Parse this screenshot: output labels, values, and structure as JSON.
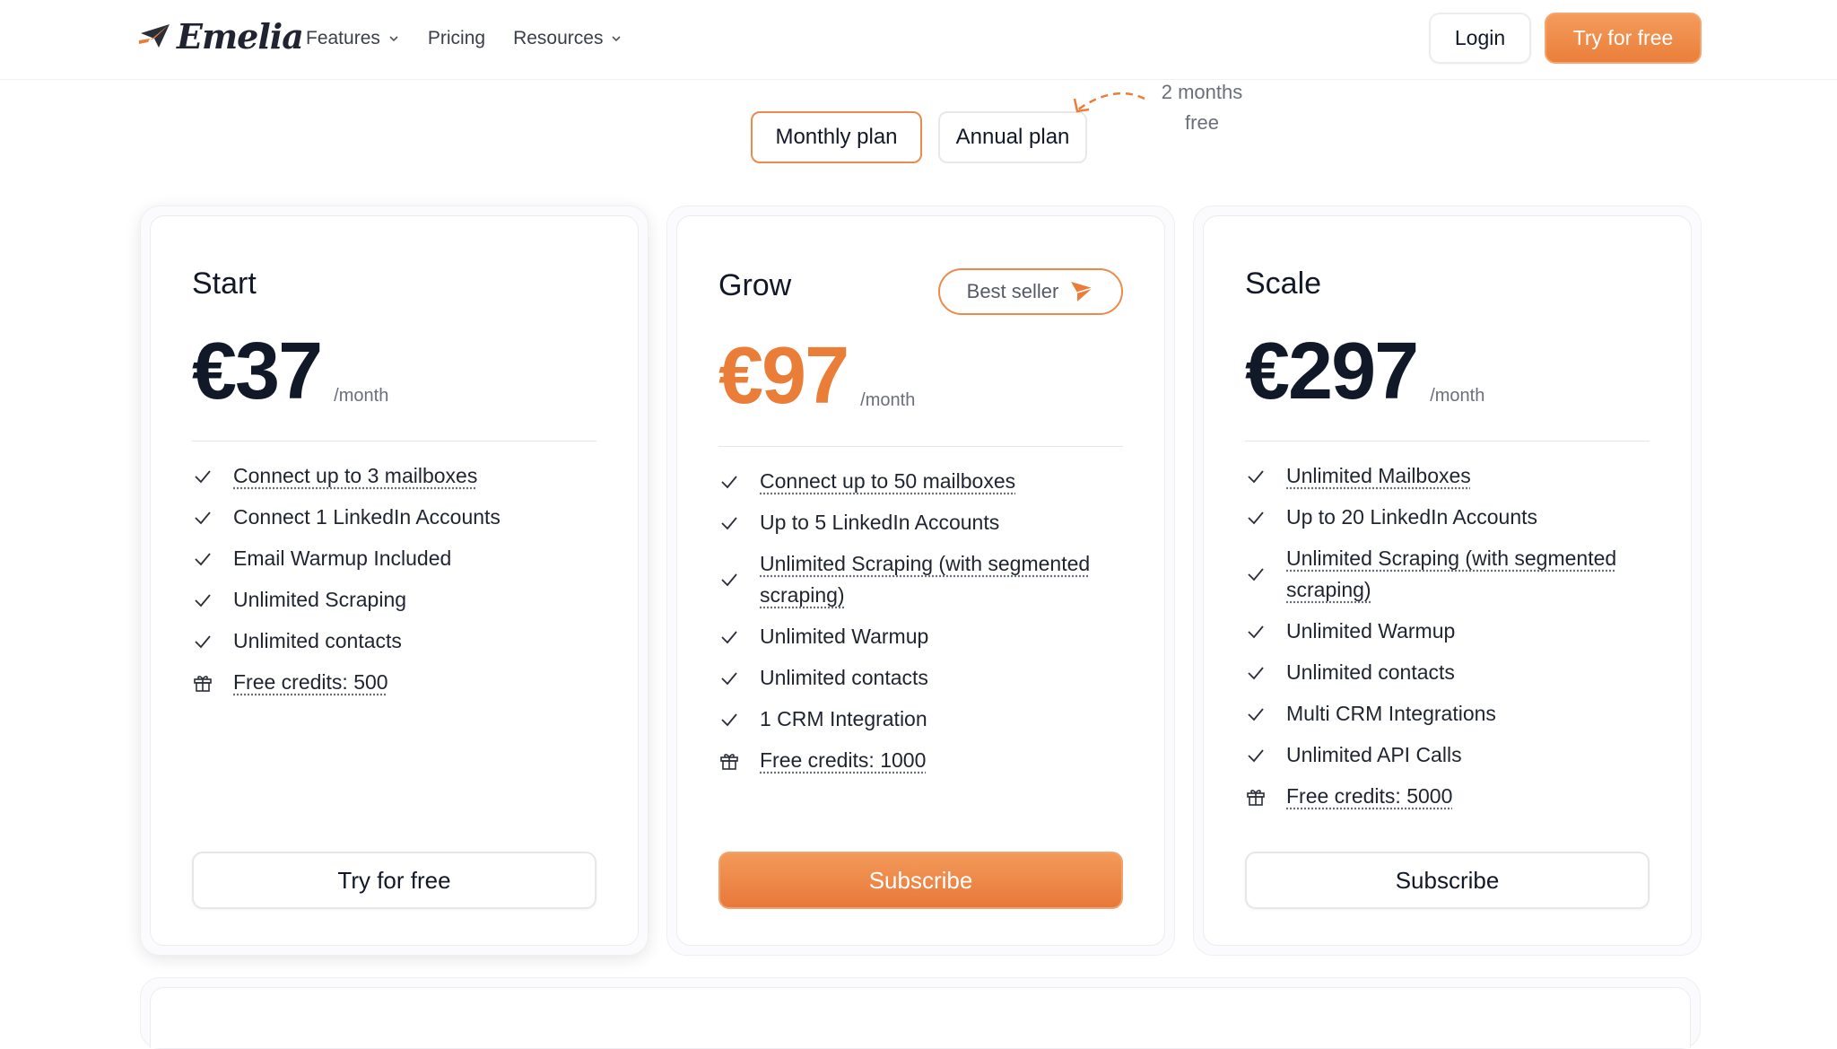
{
  "brand": {
    "name": "Emelia"
  },
  "nav": {
    "items": [
      {
        "label": "Features",
        "dropdown": true
      },
      {
        "label": "Pricing",
        "dropdown": false
      },
      {
        "label": "Resources",
        "dropdown": true
      }
    ],
    "login": "Login",
    "try": "Try for free"
  },
  "toggle": {
    "monthly": "Monthly plan",
    "annual": "Annual plan",
    "promo_line1": "2 months",
    "promo_line2": "free"
  },
  "colors": {
    "accent": "#ea7d38",
    "text": "#111827",
    "muted": "#6b6f7a"
  },
  "plans": [
    {
      "name": "Start",
      "price": "€37",
      "period": "/month",
      "features": [
        {
          "text": "Connect up to 3 mailboxes",
          "icon": "check-icon",
          "underlined": true
        },
        {
          "text": "Connect 1 LinkedIn Accounts",
          "icon": "check-icon",
          "underlined": false
        },
        {
          "text": "Email Warmup Included",
          "icon": "check-icon",
          "underlined": false
        },
        {
          "text": "Unlimited Scraping",
          "icon": "check-icon",
          "underlined": false
        },
        {
          "text": "Unlimited contacts",
          "icon": "check-icon",
          "underlined": false
        },
        {
          "text": "Free credits: 500",
          "icon": "gift-icon",
          "underlined": true
        }
      ],
      "cta": "Try for free"
    },
    {
      "name": "Grow",
      "badge": "Best seller",
      "price": "€97",
      "period": "/month",
      "features": [
        {
          "text": "Connect up to 50 mailboxes",
          "icon": "check-icon",
          "underlined": true
        },
        {
          "text": "Up to 5 LinkedIn Accounts",
          "icon": "check-icon",
          "underlined": false
        },
        {
          "text": "Unlimited Scraping (with segmented scraping)",
          "icon": "check-icon",
          "underlined": true
        },
        {
          "text": "Unlimited Warmup",
          "icon": "check-icon",
          "underlined": false
        },
        {
          "text": "Unlimited contacts",
          "icon": "check-icon",
          "underlined": false
        },
        {
          "text": "1 CRM Integration",
          "icon": "check-icon",
          "underlined": false
        },
        {
          "text": "Free credits: 1000",
          "icon": "gift-icon",
          "underlined": true
        }
      ],
      "cta": "Subscribe"
    },
    {
      "name": "Scale",
      "price": "€297",
      "period": "/month",
      "features": [
        {
          "text": "Unlimited Mailboxes",
          "icon": "check-icon",
          "underlined": true
        },
        {
          "text": "Up to 20 LinkedIn Accounts",
          "icon": "check-icon",
          "underlined": false
        },
        {
          "text": "Unlimited Scraping (with segmented scraping)",
          "icon": "check-icon",
          "underlined": true
        },
        {
          "text": "Unlimited Warmup",
          "icon": "check-icon",
          "underlined": false
        },
        {
          "text": "Unlimited contacts",
          "icon": "check-icon",
          "underlined": false
        },
        {
          "text": "Multi CRM Integrations",
          "icon": "check-icon",
          "underlined": false
        },
        {
          "text": "Unlimited API Calls",
          "icon": "check-icon",
          "underlined": false
        },
        {
          "text": "Free credits: 5000",
          "icon": "gift-icon",
          "underlined": true
        }
      ],
      "cta": "Subscribe"
    }
  ]
}
